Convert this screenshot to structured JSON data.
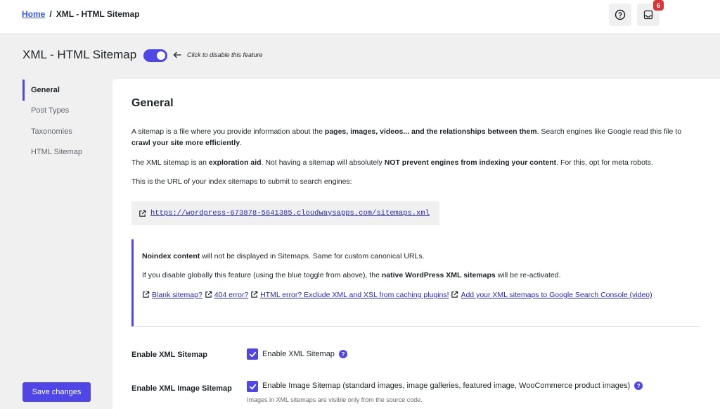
{
  "breadcrumb": {
    "home": "Home",
    "separator": "/",
    "current": "XML - HTML Sitemap"
  },
  "topbar": {
    "help_icon": "question-circle-icon",
    "notifications_icon": "inbox-icon",
    "notifications_count": "6"
  },
  "page": {
    "title": "XML - HTML Sitemap",
    "toggle_on": true,
    "toggle_hint": "Click to disable this feature",
    "accent": "#4f46e5"
  },
  "sidebar": {
    "items": [
      {
        "label": "General",
        "active": true
      },
      {
        "label": "Post Types",
        "active": false
      },
      {
        "label": "Taxonomies",
        "active": false
      },
      {
        "label": "HTML Sitemap",
        "active": false
      }
    ]
  },
  "save_button": "Save changes",
  "general": {
    "title": "General",
    "p1": {
      "a": "A sitemap is a file where you provide information about the ",
      "b": "pages, images, videos... and the relationships between them",
      "c": ". Search engines like Google read this file to ",
      "d": "crawl your site more efficiently",
      "e": "."
    },
    "p2": {
      "a": "The XML sitemap is an ",
      "b": "exploration aid",
      "c": ". Not having a sitemap will absolutely ",
      "d": "NOT prevent engines from indexing your content",
      "e": ". For this, opt for meta robots."
    },
    "p3": "This is the URL of your index sitemaps to submit to search engines:",
    "sitemap_url": "https://wordpress-673878-5641385.cloudwaysapps.com/sitemaps.xml"
  },
  "notice": {
    "line1_bold": "Noindex content",
    "line1_rest": " will not be displayed in Sitemaps. Same for custom canonical URLs.",
    "line2_a": "If you disable globally this feature (using the blue toggle from above), the ",
    "line2_bold": "native WordPress XML sitemaps",
    "line2_c": " will be re-activated.",
    "links": [
      "Blank sitemap?",
      "404 error?",
      "HTML error? Exclude XML and XSL from caching plugins!",
      "Add your XML sitemaps to Google Search Console (video)"
    ]
  },
  "settings": {
    "xml": {
      "label": "Enable XML Sitemap",
      "checkbox_label": "Enable XML Sitemap",
      "checked": true
    },
    "image": {
      "label": "Enable XML Image Sitemap",
      "checkbox_label": "Enable Image Sitemap (standard images, image galleries, featured image, WooCommerce product images)",
      "checked": true,
      "description": "Images in XML sitemaps are visible only from the source code."
    }
  }
}
